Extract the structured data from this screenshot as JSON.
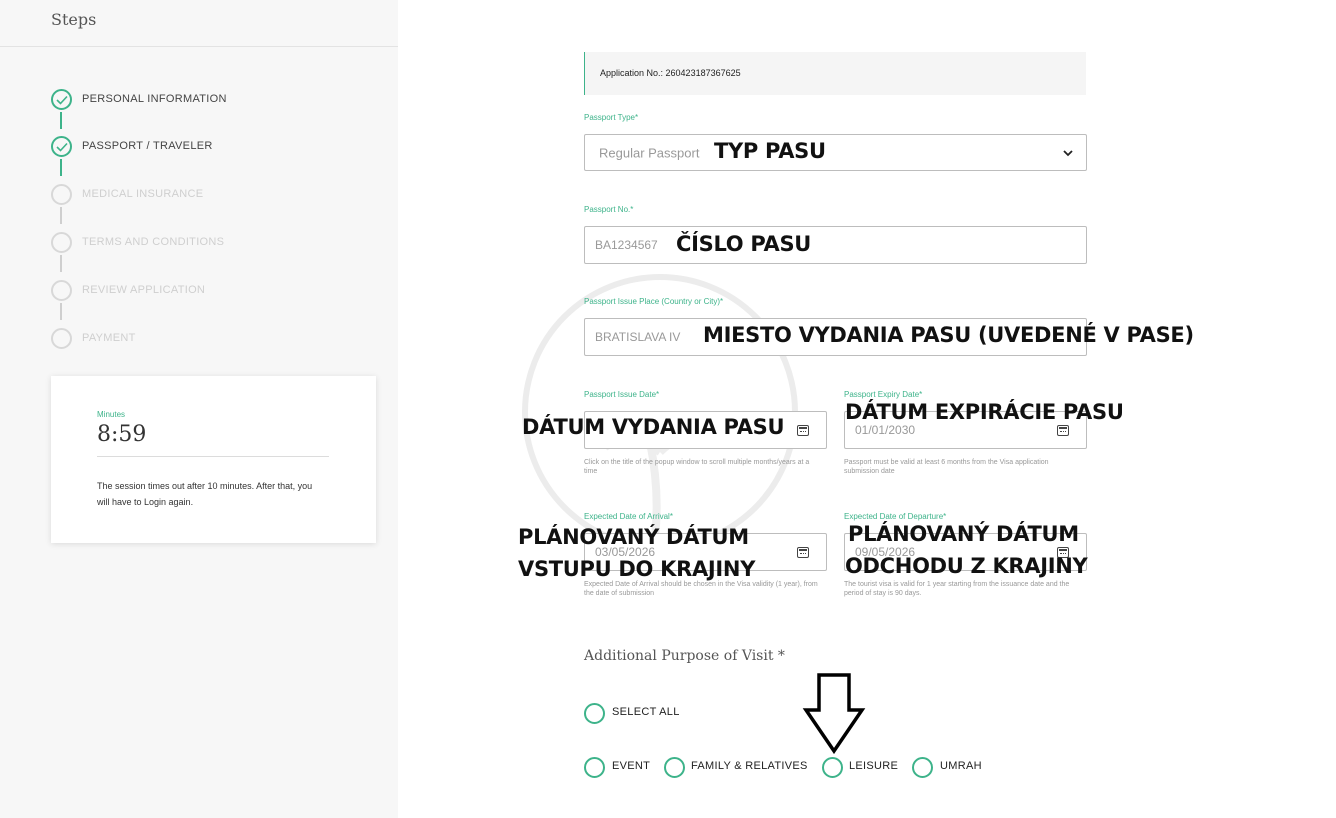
{
  "sidebar": {
    "title": "Steps",
    "steps": [
      {
        "label": "PERSONAL INFORMATION",
        "done": true
      },
      {
        "label": "PASSPORT / TRAVELER",
        "done": true
      },
      {
        "label": "MEDICAL INSURANCE",
        "done": false
      },
      {
        "label": "TERMS AND CONDITIONS",
        "done": false
      },
      {
        "label": "REVIEW APPLICATION",
        "done": false
      },
      {
        "label": "PAYMENT",
        "done": false
      }
    ],
    "timer": {
      "label": "Minutes",
      "value": "8:59",
      "note": "The session times out after 10 minutes. After that, you will have to Login again."
    }
  },
  "form": {
    "application_no": "Application No.: 260423187367625",
    "passport_type": {
      "label": "Passport Type*",
      "value": "Regular Passport"
    },
    "passport_no": {
      "label": "Passport No.*",
      "value": "BA1234567"
    },
    "issue_place": {
      "label": "Passport Issue Place (Country or City)*",
      "value": "BRATISLAVA IV"
    },
    "issue_date": {
      "label": "Passport Issue Date*",
      "value": "",
      "hint": "Click on the title of the popup window to scroll multiple months/years at a time"
    },
    "expiry_date": {
      "label": "Passport Expiry Date*",
      "value": "01/01/2030",
      "hint": "Passport must be valid at least 6 months from the Visa application submission date"
    },
    "arrival_date": {
      "label": "Expected Date of Arrival*",
      "value": "03/05/2026",
      "hint": "Expected Date of Arrival should be chosen in the Visa validity (1 year), from the date of submission"
    },
    "departure_date": {
      "label": "Expected Date of Departure*",
      "value": "09/05/2026",
      "hint": "The tourist visa is valid for 1 year starting from the issuance date and the period of stay is 90 days."
    },
    "purpose": {
      "title": "Additional Purpose of Visit *",
      "select_all": "SELECT ALL",
      "options": [
        "EVENT",
        "FAMILY & RELATIVES",
        "LEISURE",
        "UMRAH"
      ]
    }
  },
  "annotations": {
    "passport_type": "TYP PASU",
    "passport_no": "ČÍSLO PASU",
    "issue_place": "MIESTO VYDANIA PASU (UVEDENÉ V PASE)",
    "issue_date": "DÁTUM VYDANIA PASU",
    "expiry_date": "DÁTUM EXPIRÁCIE PASU",
    "arrival_line1": "PLÁNOVANÝ DÁTUM",
    "arrival_line2": "VSTUPU DO KRAJINY",
    "departure_line1": "PLÁNOVANÝ DÁTUM",
    "departure_line2": "ODCHODU Z KRAJINY"
  },
  "colors": {
    "accent": "#3db38a",
    "sidebar_bg": "#f7f7f7",
    "inactive": "#d8d8d8"
  }
}
